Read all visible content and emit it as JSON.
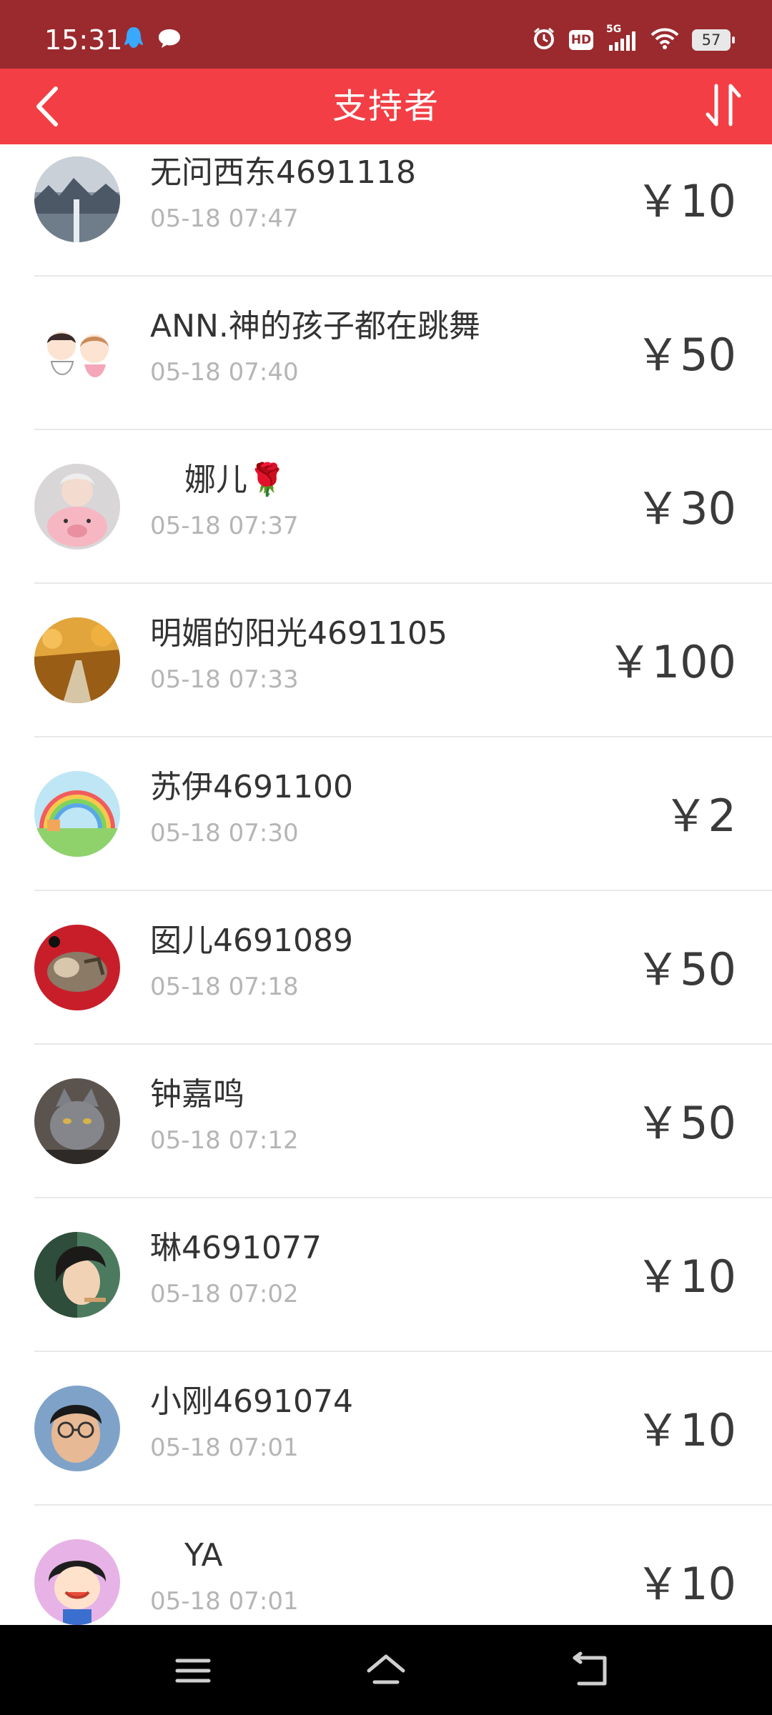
{
  "status_bar": {
    "time": "15:31",
    "left_icons": [
      "qq-bell-icon",
      "chat-bubble-icon"
    ],
    "right_icons": [
      "alarm-icon",
      "hd-icon",
      "signal-5g-icon",
      "wifi-icon"
    ],
    "hd_label": "HD",
    "signal_label": "5G",
    "battery_level": "57"
  },
  "header": {
    "title": "支持者",
    "back_icon": "chevron-left-icon",
    "sort_icon": "sort-icon",
    "background": "#f23e44"
  },
  "supporters": [
    {
      "name": "无问西东4691118",
      "time": "05-18 07:47",
      "amount": "￥10",
      "avatar": "landscape-water-avatar"
    },
    {
      "name": "ANN.神的孩子都在跳舞",
      "time": "05-18 07:40",
      "amount": "￥50",
      "avatar": "cartoon-couple-avatar"
    },
    {
      "name": "娜儿🌹",
      "time": "05-18 07:37",
      "amount": "￥30",
      "avatar": "pig-plush-avatar"
    },
    {
      "name": "明媚的阳光4691105",
      "time": "05-18 07:33",
      "amount": "￥100",
      "avatar": "autumn-path-avatar"
    },
    {
      "name": "苏伊4691100",
      "time": "05-18 07:30",
      "amount": "￥2",
      "avatar": "rainbow-avatar"
    },
    {
      "name": "囡儿4691089",
      "time": "05-18 07:18",
      "amount": "￥50",
      "avatar": "sleeping-cat-avatar"
    },
    {
      "name": "钟嘉鸣",
      "time": "05-18 07:12",
      "amount": "￥50",
      "avatar": "gray-cat-avatar"
    },
    {
      "name": "琳4691077",
      "time": "05-18 07:02",
      "amount": "￥10",
      "avatar": "girl-portrait-avatar"
    },
    {
      "name": "小刚4691074",
      "time": "05-18 07:01",
      "amount": "￥10",
      "avatar": "man-glasses-avatar"
    },
    {
      "name": "YA",
      "time": "05-18 07:01",
      "amount": "￥10",
      "avatar": "cartoon-girl-avatar"
    }
  ],
  "nav_bar": {
    "icons": [
      "menu-icon",
      "home-icon",
      "back-icon"
    ]
  }
}
